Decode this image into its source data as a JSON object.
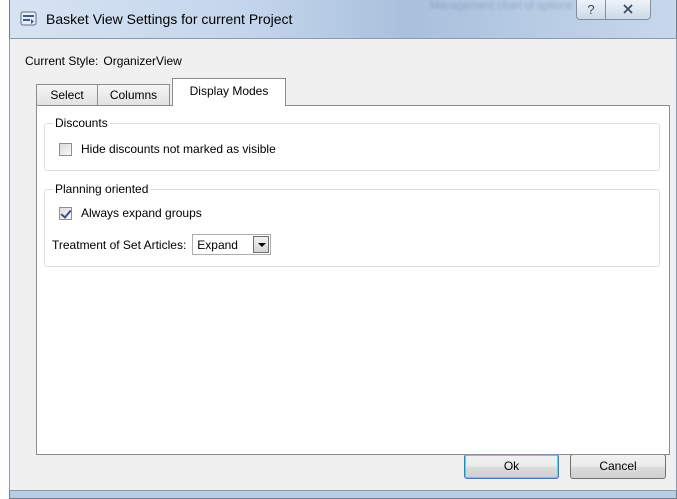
{
  "window": {
    "title": "Basket View Settings for current Project",
    "title_background_fragments": [
      "Management chart of options"
    ],
    "help_glyph": "?",
    "close_glyph": "X"
  },
  "dialog": {
    "current_style_label": "Current Style:",
    "current_style_value": "OrganizerView",
    "tabs": [
      {
        "label": "Select",
        "selected": false
      },
      {
        "label": "Columns",
        "selected": false
      },
      {
        "label": "Display Modes",
        "selected": true
      }
    ],
    "groups": {
      "discounts": {
        "title": "Discounts",
        "checkbox_label": "Hide discounts not marked as visible",
        "checked": false
      },
      "planning": {
        "title": "Planning oriented",
        "checkbox_label": "Always expand groups",
        "checked": true,
        "set_articles_label": "Treatment of Set Articles:",
        "set_articles_value": "Expand"
      }
    },
    "buttons": {
      "ok": "Ok",
      "cancel": "Cancel"
    }
  },
  "icons": {
    "app": "basket-app-icon",
    "help": "help-icon",
    "close": "close-icon",
    "dropdown": "chevron-down-icon"
  },
  "colors": {
    "titlebar": "#c4d6ec",
    "client_bg": "#f0f0f0",
    "panel_bg": "#ffffff",
    "groupbox_border": "#d5dfe5",
    "check_mark": "#3c4f8a"
  }
}
